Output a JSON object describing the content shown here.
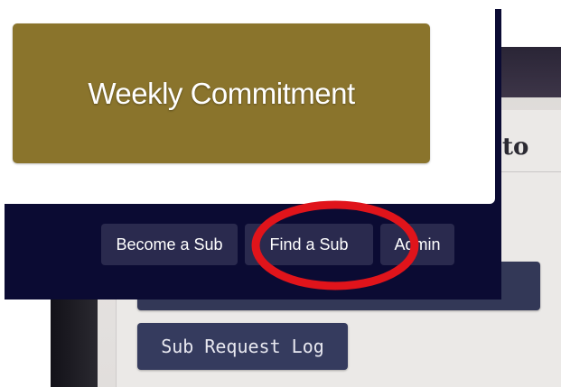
{
  "background_screen": {
    "header_fragment": "to",
    "log_button_label": "Sub Request Log"
  },
  "main": {
    "weekly_commitment_label": "Weekly Commitment"
  },
  "nav": {
    "become_sub_label": "Become a Sub",
    "find_sub_label": "Find a Sub",
    "admin_label": "Admin"
  },
  "colors": {
    "weekly_button": "#8a742c",
    "nav_button": "#2a2a4e",
    "overlay_background": "#0b0b33",
    "highlight": "#e0141b"
  }
}
